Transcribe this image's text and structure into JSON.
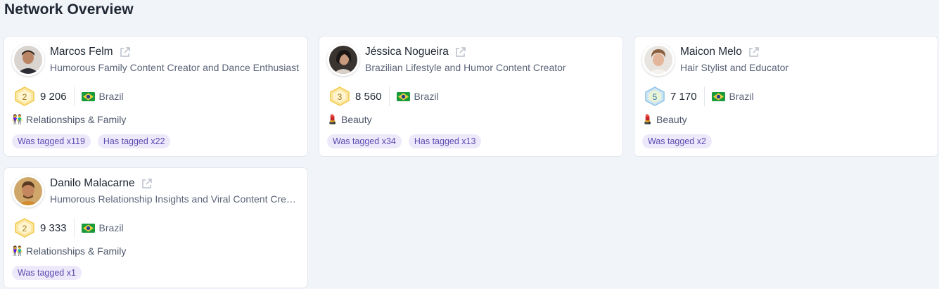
{
  "page": {
    "title": "Network Overview"
  },
  "colors": {
    "tag_bg": "#ede9fb",
    "tag_text": "#5b4bb0",
    "gold": "#f2c94c",
    "diamond": "#6fb3e0"
  },
  "cards": [
    {
      "name": "Marcos Felm",
      "bio": "Humorous Family Content Creator and Dance Enthusiast",
      "level": "2",
      "level_tier": "gold",
      "followers": "9 206",
      "country": "Brazil",
      "category_icon": "family-icon",
      "category_emoji": "👫",
      "category": "Relationships & Family",
      "tags": [
        "Was tagged x119",
        "Has tagged x22"
      ]
    },
    {
      "name": "Jéssica Nogueira",
      "bio": "Brazilian Lifestyle and Humor Content Creator",
      "level": "3",
      "level_tier": "gold",
      "followers": "8 560",
      "country": "Brazil",
      "category_icon": "lipstick-icon",
      "category_emoji": "💄",
      "category": "Beauty",
      "tags": [
        "Was tagged x34",
        "Has tagged x13"
      ]
    },
    {
      "name": "Maicon Melo",
      "bio": "Hair Stylist and Educator",
      "level": "5",
      "level_tier": "diamond",
      "followers": "7 170",
      "country": "Brazil",
      "category_icon": "lipstick-icon",
      "category_emoji": "💄",
      "category": "Beauty",
      "tags": [
        "Was tagged x2"
      ]
    },
    {
      "name": "Danilo Malacarne",
      "bio": "Humorous Relationship Insights and Viral Content Creator",
      "level": "2",
      "level_tier": "gold",
      "followers": "9 333",
      "country": "Brazil",
      "category_icon": "family-icon",
      "category_emoji": "👫",
      "category": "Relationships & Family",
      "tags": [
        "Was tagged x1"
      ]
    }
  ]
}
